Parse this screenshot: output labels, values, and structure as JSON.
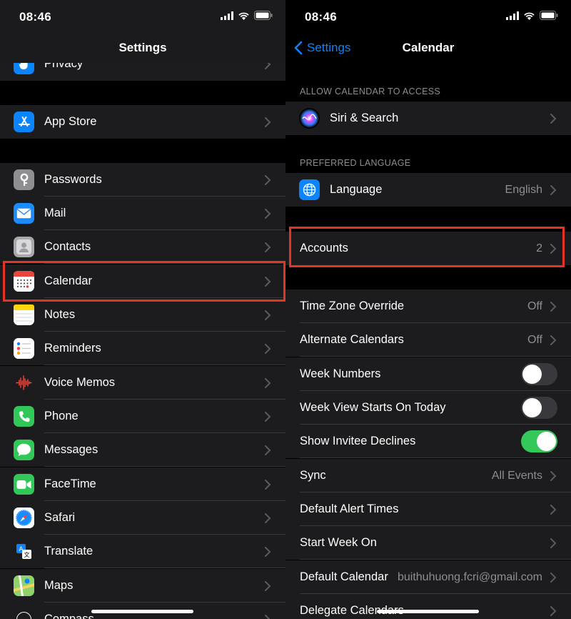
{
  "status": {
    "time": "08:46"
  },
  "left": {
    "title": "Settings",
    "rows": [
      {
        "label": "Privacy",
        "icon": "privacy-hand-icon",
        "color": "#0a84ff"
      },
      {
        "label": "App Store",
        "icon": "app-store-icon",
        "color": "#0a84ff"
      },
      {
        "label": "Passwords",
        "icon": "key-icon",
        "color": "#8e8e93"
      },
      {
        "label": "Mail",
        "icon": "mail-icon",
        "color": "#1a8cff"
      },
      {
        "label": "Contacts",
        "icon": "contacts-icon",
        "color": "#a7a7ac"
      },
      {
        "label": "Calendar",
        "icon": "calendar-icon",
        "color": "#ffffff"
      },
      {
        "label": "Notes",
        "icon": "notes-icon",
        "color": "#ffd60a"
      },
      {
        "label": "Reminders",
        "icon": "reminders-icon",
        "color": "#ffffff"
      },
      {
        "label": "Voice Memos",
        "icon": "voice-memos-icon",
        "color": "#1c1c1e"
      },
      {
        "label": "Phone",
        "icon": "phone-icon",
        "color": "#32c759"
      },
      {
        "label": "Messages",
        "icon": "messages-icon",
        "color": "#32c759"
      },
      {
        "label": "FaceTime",
        "icon": "facetime-icon",
        "color": "#32c759"
      },
      {
        "label": "Safari",
        "icon": "safari-icon",
        "color": "#1a8cff"
      },
      {
        "label": "Translate",
        "icon": "translate-icon",
        "color": "#1c1c1e"
      },
      {
        "label": "Maps",
        "icon": "maps-icon",
        "color": "#8fd16a"
      },
      {
        "label": "Compass",
        "icon": "compass-icon",
        "color": "#1c1c1e"
      }
    ]
  },
  "right": {
    "back_label": "Settings",
    "title": "Calendar",
    "section_access": "ALLOW CALENDAR TO ACCESS",
    "siri_label": "Siri & Search",
    "section_language": "PREFERRED LANGUAGE",
    "language_label": "Language",
    "language_value": "English",
    "accounts_label": "Accounts",
    "accounts_value": "2",
    "rows": [
      {
        "label": "Time Zone Override",
        "value": "Off",
        "kind": "chevron"
      },
      {
        "label": "Alternate Calendars",
        "value": "Off",
        "kind": "chevron"
      },
      {
        "label": "Week Numbers",
        "value": "",
        "kind": "toggle",
        "on": false
      },
      {
        "label": "Week View Starts On Today",
        "value": "",
        "kind": "toggle",
        "on": false
      },
      {
        "label": "Show Invitee Declines",
        "value": "",
        "kind": "toggle",
        "on": true
      },
      {
        "label": "Sync",
        "value": "All Events",
        "kind": "chevron"
      },
      {
        "label": "Default Alert Times",
        "value": "",
        "kind": "chevron"
      },
      {
        "label": "Start Week On",
        "value": "",
        "kind": "chevron"
      },
      {
        "label": "Default Calendar",
        "value": "buithuhuong.fcri@gmail.com",
        "kind": "chevron"
      },
      {
        "label": "Delegate Calendars",
        "value": "",
        "kind": "chevron"
      }
    ]
  },
  "colors": {
    "accent": "#0a84ff",
    "highlight": "#e53326",
    "toggle_on": "#34c759"
  }
}
